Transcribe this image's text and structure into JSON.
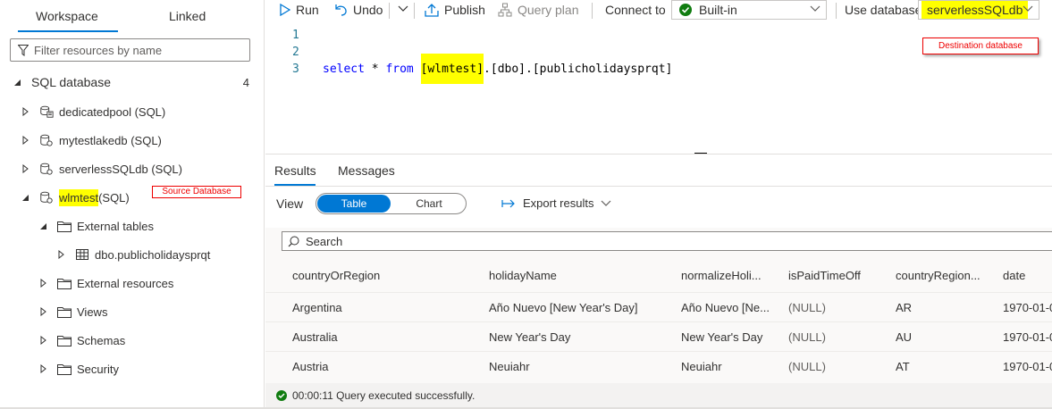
{
  "left_panel": {
    "tabs": [
      {
        "label": "Workspace",
        "active": true
      },
      {
        "label": "Linked",
        "active": false
      }
    ],
    "filter_placeholder": "Filter resources by name",
    "section": {
      "label": "SQL database",
      "count": "4"
    },
    "tree": [
      {
        "label": "dedicatedpool (SQL)",
        "icon": "dedicated-pool-icon"
      },
      {
        "label": "mytestlakedb (SQL)",
        "icon": "database-icon"
      },
      {
        "label": "serverlessSQLdb (SQL)",
        "icon": "database-icon"
      },
      {
        "label_highlight": "wlmtest",
        "label_rest": " (SQL)",
        "icon": "database-icon",
        "expanded": true
      },
      {
        "label": "External tables",
        "icon": "folder-icon",
        "expanded": true
      },
      {
        "label": "dbo.publicholidaysprqt",
        "icon": "table-icon"
      },
      {
        "label": "External resources",
        "icon": "folder-icon"
      },
      {
        "label": "Views",
        "icon": "folder-icon"
      },
      {
        "label": "Schemas",
        "icon": "folder-icon"
      },
      {
        "label": "Security",
        "icon": "folder-icon"
      }
    ],
    "source_annotation": "Source Database"
  },
  "toolbar": {
    "run": "Run",
    "undo": "Undo",
    "publish": "Publish",
    "query_plan": "Query plan",
    "connect_to_label": "Connect to",
    "connect_to_value": "Built-in",
    "use_database_label": "Use database",
    "use_database_value": "serverlessSQLdb"
  },
  "editor": {
    "line_numbers": [
      "1",
      "2",
      "3"
    ],
    "code": {
      "kw1": "select",
      "star": " * ",
      "kw2": "from",
      "space": " ",
      "db": "[wlmtest]",
      "rest": ".[dbo].[publicholidaysprqt]"
    },
    "destination_annotation": "Destination database"
  },
  "results": {
    "tabs": [
      {
        "label": "Results",
        "active": true
      },
      {
        "label": "Messages",
        "active": false
      }
    ],
    "view_label": "View",
    "view_options": {
      "table": "Table",
      "chart": "Chart",
      "selected": "Table"
    },
    "export_label": "Export results",
    "search_placeholder": "Search",
    "columns": [
      "countryOrRegion",
      "holidayName",
      "normalizeHoli...",
      "isPaidTimeOff",
      "countryRegion...",
      "date"
    ],
    "rows": [
      [
        "Argentina",
        "Año Nuevo [New Year's Day]",
        "Año Nuevo [Ne...",
        "(NULL)",
        "AR",
        "1970-01-0"
      ],
      [
        "Australia",
        "New Year's Day",
        "New Year's Day",
        "(NULL)",
        "AU",
        "1970-01-0"
      ],
      [
        "Austria",
        "Neuiahr",
        "Neuiahr",
        "(NULL)",
        "AT",
        "1970-01-0"
      ]
    ],
    "status": "00:00:11 Query executed successfully."
  },
  "colors": {
    "accent": "#0078d4",
    "highlight": "#ffff00",
    "annotation": "#ee0000",
    "success": "#107c10"
  }
}
